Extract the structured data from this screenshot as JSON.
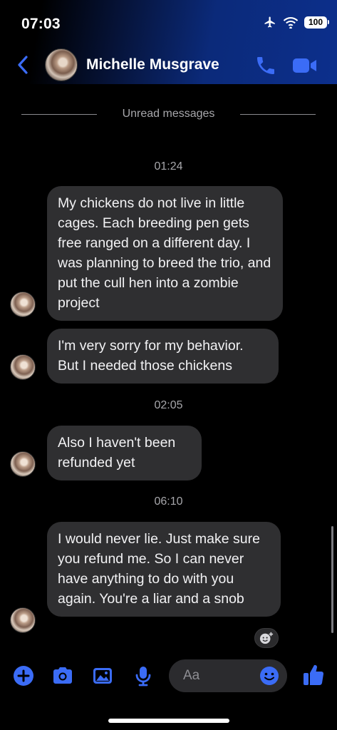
{
  "status": {
    "time": "07:03",
    "battery": "100"
  },
  "header": {
    "contact_name": "Michelle Musgrave"
  },
  "divider": {
    "unread_label": "Unread messages"
  },
  "thread": {
    "timestamps": [
      "01:24",
      "02:05",
      "06:10"
    ],
    "messages": [
      "My chickens do not live in little cages. Each breeding pen gets free ranged on a different day. I was planning to breed the trio, and put the cull hen into a zombie project",
      "I'm very sorry for my behavior. But I needed those chickens",
      "Also I haven't been refunded yet",
      "I would never lie. Just make sure you refund me. So I can never have anything to do with you again. You're a liar and a snob"
    ]
  },
  "composer": {
    "placeholder": "Aa"
  },
  "colors": {
    "accent": "#3b6cf6",
    "bubble": "#2f2f31",
    "header_blue": "#0c2f8c"
  }
}
